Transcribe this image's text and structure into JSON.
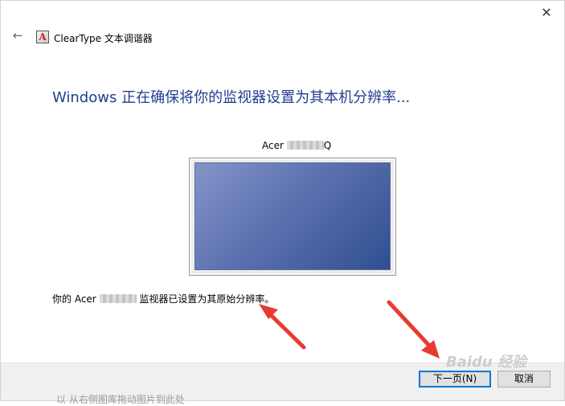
{
  "window": {
    "close_glyph": "✕"
  },
  "topbar": {
    "back_glyph": "←",
    "app_icon_glyph": "A",
    "title": "ClearType 文本调谐器"
  },
  "main": {
    "heading": "Windows 正在确保将你的监视器设置为其本机分辨率...",
    "monitor_label_prefix": "Acer",
    "monitor_label_suffix": "Q",
    "result_prefix": "你的 Acer",
    "result_suffix": "监视器已设置为其原始分辨率。"
  },
  "footer": {
    "next_label": "下一页(N)",
    "cancel_label": "取消"
  },
  "overlay": {
    "watermark": "Baidu 经验",
    "caption_fragment": "以 从右侧图库拖动图片到此处",
    "arrow_color": "#e83a34"
  }
}
